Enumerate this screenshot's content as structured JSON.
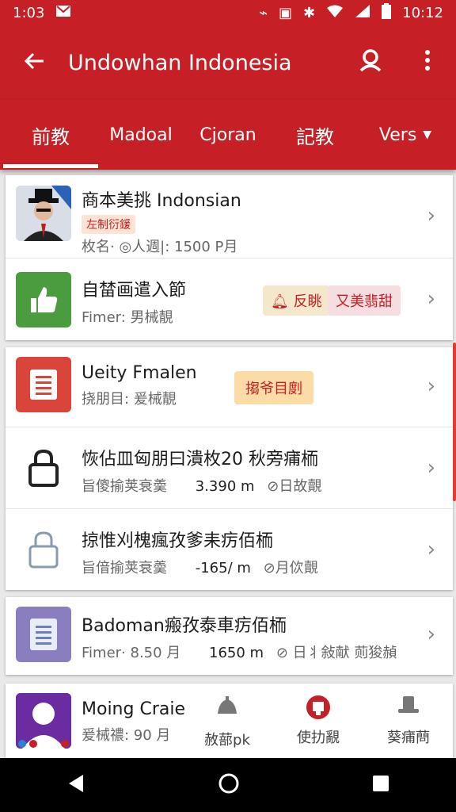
{
  "status": {
    "time_left": "1:03",
    "time_right": "10:12"
  },
  "appbar": {
    "title": "Undowhan Indonesia"
  },
  "tabs": [
    "前教",
    "Madoal",
    "Cjoran",
    "記教",
    "Vers"
  ],
  "card1": [
    {
      "title": "商本美挑 Indonsian",
      "badge": "左制衍鍰",
      "sub": "枚名· ◎人週|: 1500 P月"
    },
    {
      "title": "自榃画遣入節",
      "sub": "Fimer: 男械靚",
      "pill1": "反眺",
      "pill2": "又美翡甜"
    }
  ],
  "card2": [
    {
      "title": "Ueity Fmalen",
      "sub": "挠朋目: 爰械靚",
      "pill": "搊爷目剫"
    },
    {
      "title": "恢佔皿匈朋曰潰枚20 秋旁痡栭",
      "sub_left": "旨傻揄荚衰羮",
      "sub_mid": "3.390 m",
      "sub_right": "⊘日故覿"
    },
    {
      "title": "掠惟刈槐瘋孜爹耒疠佰栭",
      "sub_left": "旨偣揄荚衰羮",
      "sub_mid": "-165/ m",
      "sub_right": "⊘月佽覿"
    }
  ],
  "card3": {
    "title": "Badoman瘢孜泰車疠佰栭",
    "sub_left": "Fimer· 8.50 月",
    "sub_mid": "1650 m",
    "sub_right": "⊘ 日丬敍献 荝狻赬"
  },
  "card4": {
    "title": "Moing Craie",
    "sub": "爰械禯: 90 月",
    "actions": [
      "赦蔀pk",
      "使扐覶",
      "葵痡蔄"
    ]
  },
  "colors": {
    "primary": "#c62026",
    "green": "#4a9c3f",
    "red": "#d9443b",
    "purple": "#8b7ec0"
  }
}
